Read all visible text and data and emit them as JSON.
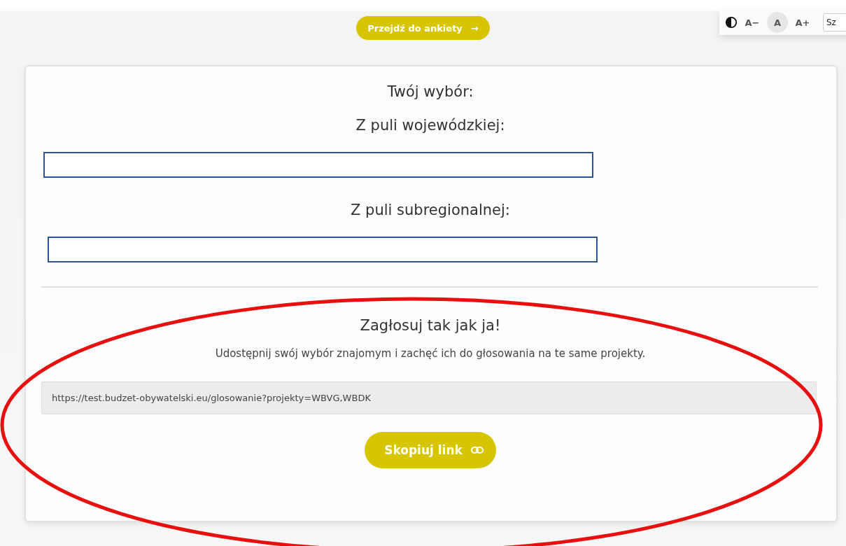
{
  "survey_button": {
    "label": "Przejdź do ankiety",
    "icon": "→"
  },
  "accessibility_toolbar": {
    "font_sizes": [
      {
        "label": "A−",
        "selected": false
      },
      {
        "label": "A",
        "selected": true
      },
      {
        "label": "A+",
        "selected": false
      }
    ],
    "search": {
      "placeholder": "Sz"
    }
  },
  "card": {
    "title": "Twój wybór:",
    "pools": [
      {
        "label": "Z puli wojewódzkiej:"
      },
      {
        "label": "Z puli subregionalnej:"
      }
    ],
    "share": {
      "heading": "Zagłosuj tak jak ja!",
      "description": "Udostępnij swój wybór znajomym i zachęć ich do głosowania na te same projekty.",
      "link": "https://test.budzet-obywatelski.eu/glosowanie?projekty=WBVG,WBDK",
      "copy_button": "Skopiuj link"
    }
  },
  "annotation": {
    "kind": "ellipse",
    "color": "#e8100f"
  }
}
